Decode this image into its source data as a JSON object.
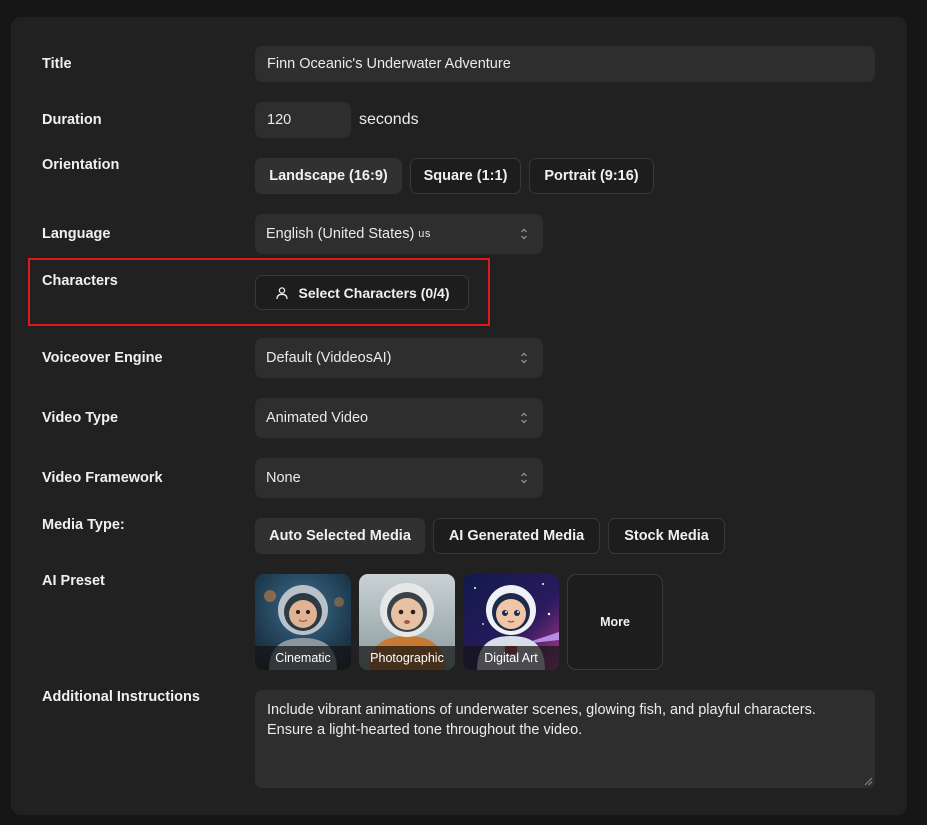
{
  "fields": {
    "title": {
      "label": "Title",
      "value": "Finn Oceanic's Underwater Adventure"
    },
    "duration": {
      "label": "Duration",
      "value": "120",
      "unit": "seconds"
    },
    "orientation": {
      "label": "Orientation",
      "options": [
        "Landscape (16:9)",
        "Square (1:1)",
        "Portrait (9:16)"
      ],
      "selected": "Landscape (16:9)"
    },
    "language": {
      "label": "Language",
      "value": "English (United States)",
      "flag": "us"
    },
    "characters": {
      "label": "Characters",
      "button_label": "Select Characters (0/4)"
    },
    "voiceover_engine": {
      "label": "Voiceover Engine",
      "value": "Default (ViddeosAI)"
    },
    "video_type": {
      "label": "Video Type",
      "value": "Animated Video"
    },
    "video_framework": {
      "label": "Video Framework",
      "value": "None"
    },
    "media_type": {
      "label": "Media Type:",
      "options": [
        "Auto Selected Media",
        "AI Generated Media",
        "Stock Media"
      ],
      "selected": "Auto Selected Media"
    },
    "ai_preset": {
      "label": "AI Preset",
      "presets": [
        "Cinematic",
        "Photographic",
        "Digital Art"
      ],
      "more_label": "More"
    },
    "additional_instructions": {
      "label": "Additional Instructions",
      "value": "Include vibrant animations of underwater scenes, glowing fish, and playful characters. Ensure a light-hearted tone throughout the video."
    }
  },
  "colors": {
    "highlight": "#e01818",
    "panel": "#212121",
    "input": "#2e2e2e"
  }
}
